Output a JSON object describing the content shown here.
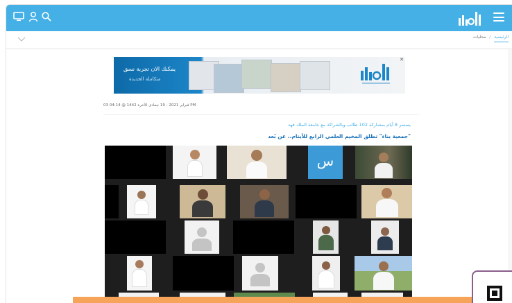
{
  "header": {
    "logo_alt": "logo",
    "icons": [
      "monitor-icon",
      "user-icon",
      "search-icon",
      "menu-icon"
    ],
    "bg_color": "#45b0e6"
  },
  "breadcrumb": {
    "home": "الرئيسية",
    "current": "محليات"
  },
  "ad": {
    "line1": "يمكنك الان تجربة نسق",
    "line2": "متكاملة الجديدة",
    "close": "✕"
  },
  "article": {
    "date": "03 فبراير 2021 - 19 جمادى الآخرة 1442 @ 04:14 PM",
    "subtitle": "يستمر 8 أيام بمشاركة 102 طالب وبالشراكة مع جامعة الملك فهد",
    "headline": "\"جمعية بناء\" تطلق المخيم العلمي الرابع للأيتام.. عن بُعد",
    "image_tile_letter": "س"
  },
  "colors": {
    "accent": "#45b0e6",
    "link": "#1a73b8",
    "orange": "#f5a45a"
  }
}
